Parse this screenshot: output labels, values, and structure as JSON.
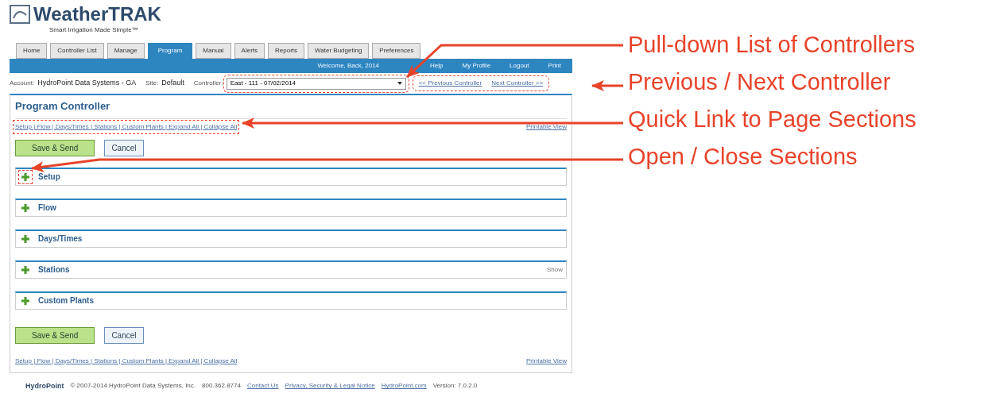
{
  "logo": {
    "name": "WeatherTRAK",
    "tagline": "Smart Irrigation Made Simple™"
  },
  "tabs": [
    {
      "label": "Home",
      "selected": false
    },
    {
      "label": "Controller List",
      "selected": false
    },
    {
      "label": "Manage",
      "selected": false
    },
    {
      "label": "Program",
      "selected": true
    },
    {
      "label": "Manual",
      "selected": false
    },
    {
      "label": "Alerts",
      "selected": false
    },
    {
      "label": "Reports",
      "selected": false
    },
    {
      "label": "Water Budgeting",
      "selected": false
    },
    {
      "label": "Preferences",
      "selected": false
    }
  ],
  "nav_bar": {
    "links": [
      "Welcome, Back, 2014",
      "Help",
      "My Profile",
      "Logout",
      "Print"
    ]
  },
  "context_bar": {
    "account_label": "Account:",
    "account": "HydroPoint Data Systems - GA",
    "site_label": "Site:",
    "site": "Default",
    "controller_label": "Controller:",
    "controller": "East - 111 - 07/02/2014",
    "previous": "<< Previous Controller",
    "next": "Next Controller >>"
  },
  "panel": {
    "title": "Program Controller",
    "top": {
      "quick_links": "Setup | Flow | Days/Times | Stations | Custom Plants | Expand All | Collapse All",
      "printable_view": "Printable View",
      "save_button": "Save & Send",
      "cancel_button": "Cancel"
    },
    "sections": [
      {
        "title": "Setup",
        "expanded": false,
        "highlighted": true
      },
      {
        "title": "Flow",
        "expanded": false,
        "highlighted": false
      },
      {
        "title": "Days/Times",
        "expanded": false,
        "highlighted": false
      },
      {
        "title": "Stations",
        "expanded": false,
        "highlighted": false,
        "action": "Show"
      },
      {
        "title": "Custom Plants",
        "expanded": false,
        "highlighted": false
      }
    ],
    "bottom": {
      "quick_links": "Setup | Flow | Days/Times | Stations | Custom Plants | Expand All | Collapse All",
      "printable_view": "Printable View",
      "save_button": "Save & Send",
      "cancel_button": "Cancel"
    }
  },
  "footer": {
    "brand": "HydroPoint",
    "copyright": "© 2007-2014 HydroPoint Data Systems, Inc.",
    "phone": "800.362.8774",
    "links": [
      "Contact Us",
      "Privacy, Security & Legal Notice",
      "HydroPoint.com"
    ],
    "version": "Version: 7.0.2.0"
  },
  "annotations": [
    {
      "text": "Pull-down List of Controllers"
    },
    {
      "text": "Previous / Next Controller"
    },
    {
      "text": "Quick Link to Page Sections"
    },
    {
      "text": "Open / Close Sections"
    }
  ]
}
